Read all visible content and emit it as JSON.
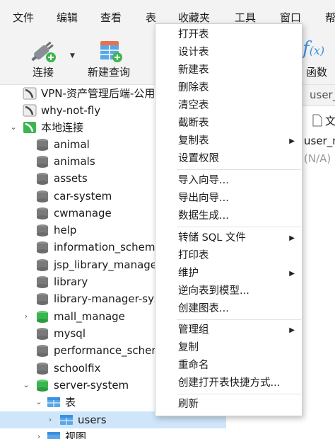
{
  "menubar": {
    "items": [
      "文件",
      "编辑",
      "查看",
      "表",
      "收藏夹",
      "工具",
      "窗口",
      "帮"
    ]
  },
  "toolbar": {
    "connect_label": "连接",
    "new_query_label": "新建查询",
    "function_label": "函数"
  },
  "tree": {
    "connections": [
      {
        "label": "VPN-资产管理后端-公用"
      },
      {
        "label": "why-not-fly"
      },
      {
        "label": "本地连接"
      }
    ],
    "databases": [
      "animal",
      "animals",
      "assets",
      "car-system",
      "cwmanage",
      "help",
      "information_schema",
      "jsp_library_manager",
      "library",
      "library-manager-system",
      "mall_manage",
      "mysql",
      "performance_schema",
      "schoolfix",
      "server-system"
    ],
    "tables_folder": "表",
    "selected_table": "users",
    "views_folder": "视图"
  },
  "right_panel": {
    "tab_partial": "user_",
    "col_header": "文",
    "cell_name": "user_n",
    "cell_value": "(N/A)"
  },
  "context_menu": {
    "items": [
      {
        "label": "打开表"
      },
      {
        "label": "设计表"
      },
      {
        "label": "新建表"
      },
      {
        "label": "删除表"
      },
      {
        "label": "清空表"
      },
      {
        "label": "截断表"
      },
      {
        "label": "复制表",
        "submenu": true
      },
      {
        "label": "设置权限"
      },
      {
        "label": "导入向导..."
      },
      {
        "label": "导出向导..."
      },
      {
        "label": "数据生成..."
      },
      {
        "label": "转储 SQL 文件",
        "submenu": true
      },
      {
        "label": "打印表"
      },
      {
        "label": "维护",
        "submenu": true
      },
      {
        "label": "逆向表到模型..."
      },
      {
        "label": "创建图表..."
      },
      {
        "label": "管理组",
        "submenu": true
      },
      {
        "label": "复制"
      },
      {
        "label": "重命名"
      },
      {
        "label": "创建打开表快捷方式..."
      },
      {
        "label": "刷新"
      }
    ]
  },
  "colors": {
    "selection": "#cfe6fa",
    "db_green": "#3cb550",
    "db_gray": "#7a7a7a",
    "folder_blue": "#3d8fe0"
  }
}
